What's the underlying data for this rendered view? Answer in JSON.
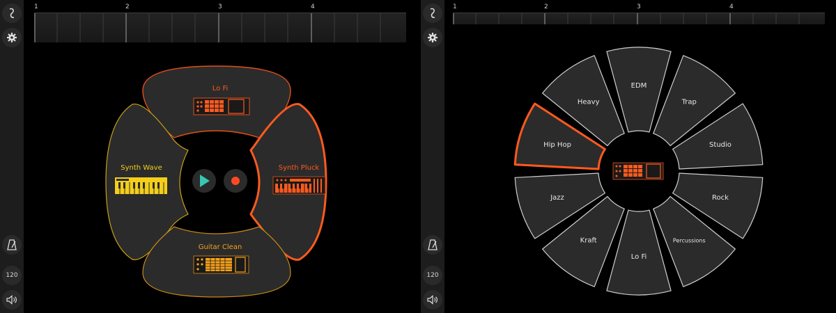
{
  "left": {
    "timeline": {
      "markers": [
        "1",
        "2",
        "3",
        "4"
      ]
    },
    "sidebar": {
      "tempo": "120"
    },
    "pads": {
      "top": "Lo Fi",
      "left": "Synth Wave",
      "right": "Synth Pluck",
      "bottom": "Guitar Clean"
    },
    "center": {
      "play": "play-button",
      "record": "record-button"
    }
  },
  "right": {
    "timeline": {
      "markers": [
        "1",
        "2",
        "3",
        "4"
      ]
    },
    "sidebar": {
      "tempo": "120"
    },
    "genres": [
      "EDM",
      "Trap",
      "Studio",
      "Rock",
      "Percussions",
      "Lo Fi",
      "Kraft",
      "Jazz",
      "Hip Hop",
      "Heavy"
    ],
    "selected": "Hip Hop"
  },
  "colors": {
    "accent": "#ff5a1f",
    "accent_dark": "#e2501a",
    "yellow": "#f4cf1a",
    "pad_fill": "#2b2b2b",
    "play": "#38c7b0",
    "record": "#ff4a24"
  }
}
